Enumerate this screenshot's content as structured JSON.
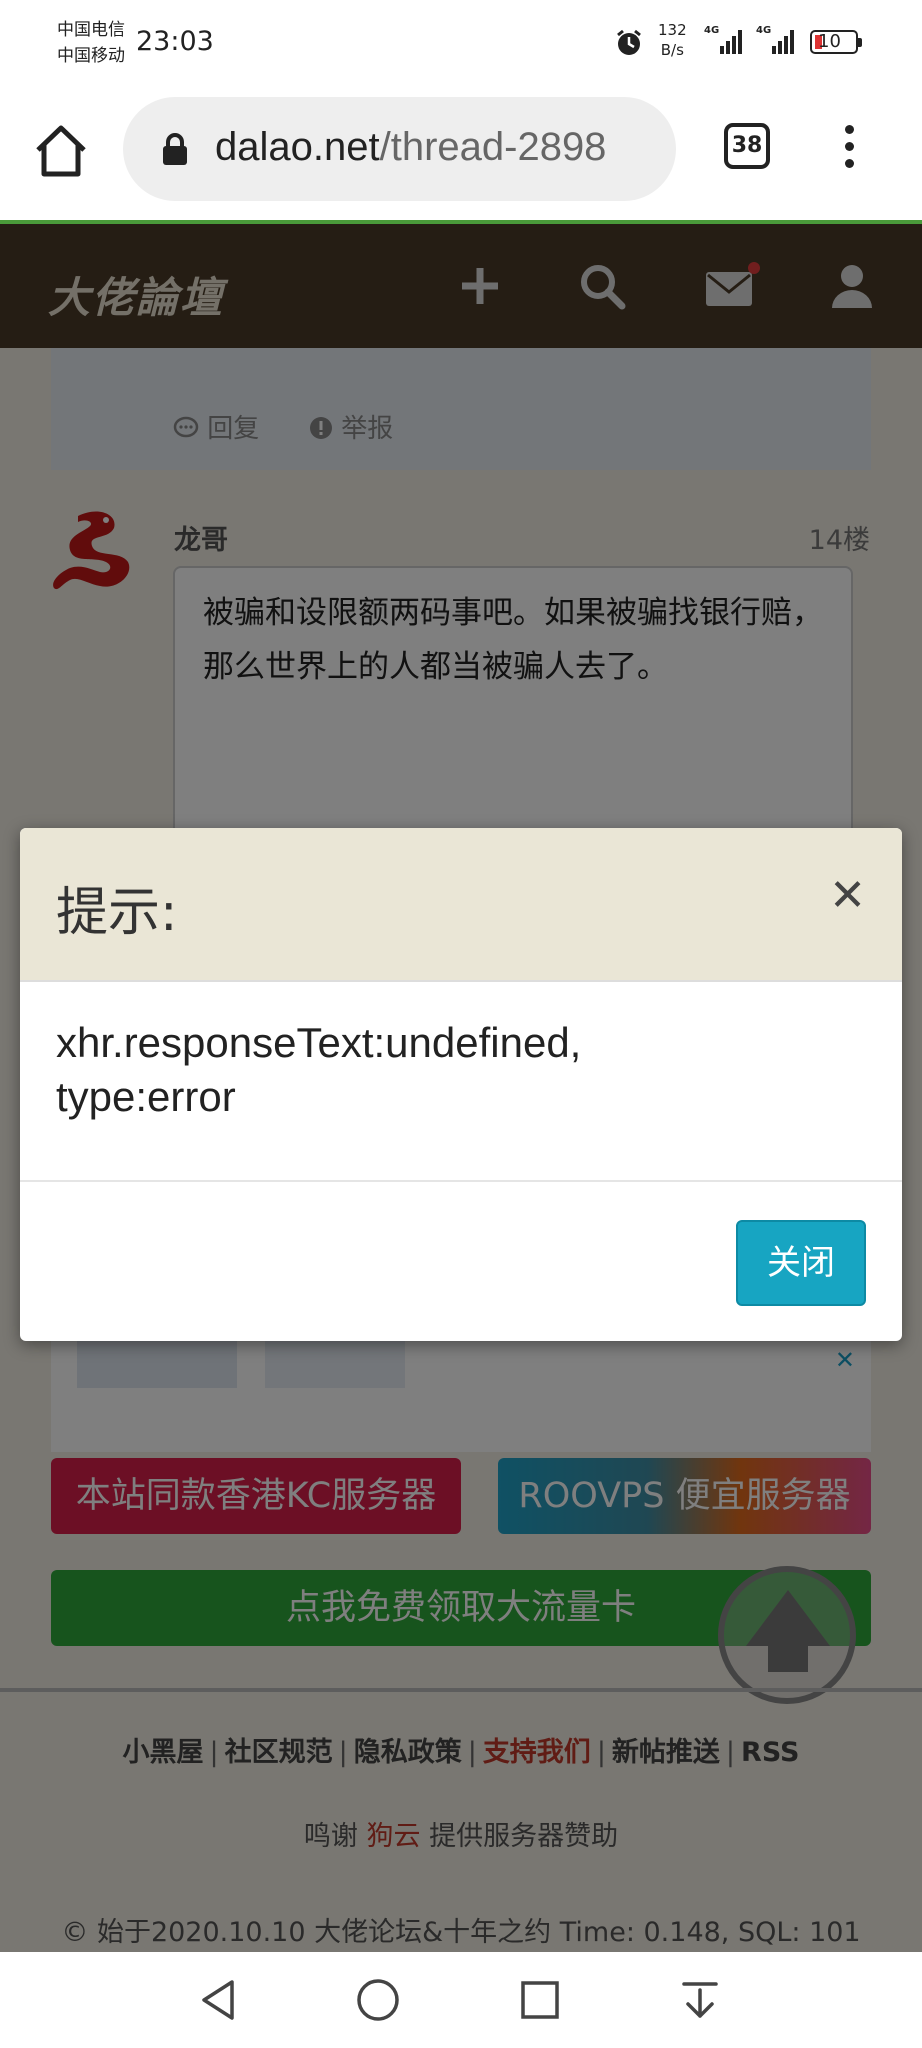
{
  "status_bar": {
    "carrier1": "中国电信",
    "carrier2": "中国移动",
    "time": "23:03",
    "net_speed_value": "132",
    "net_speed_unit": "B/s",
    "signal1_label": "4G",
    "signal2_label": "4G",
    "battery": "10"
  },
  "browser": {
    "url_domain": "dalao.net",
    "url_path": "/thread-2898",
    "tab_count": "38"
  },
  "site": {
    "logo": "大佬論壇"
  },
  "previous_post": {
    "reply": "回复",
    "report": "举报"
  },
  "post": {
    "author": "龙哥",
    "floor": "14楼",
    "text": "被骗和设限额两码事吧。如果被骗找银行赔，那么世界上的人都当被骗人去了。"
  },
  "promo": {
    "hk_server": "本站同款香港KC服务器",
    "roovps": "ROOVPS 便宜服务器",
    "data_card": "点我免费领取大流量卡"
  },
  "footer": {
    "links": [
      "小黑屋",
      "社区规范",
      "隐私政策",
      "支持我们",
      "新帖推送",
      "RSS"
    ],
    "thanks_prefix": "鸣谢",
    "thanks_sponsor": "狗云",
    "thanks_suffix": "提供服务器赞助",
    "copyright": "© 始于2020.10.10 大佬论坛&十年之约 Time: 0.148, SQL: 101"
  },
  "modal": {
    "title": "提示:",
    "message_line1": "xhr.responseText:undefined,",
    "message_line2": "type:error",
    "close_label": "关闭"
  },
  "colors": {
    "header_bg": "#4a3a28",
    "modal_button": "#17a5c2",
    "hk_button": "#d81e4a",
    "card_button": "#2fa83a",
    "highlight": "#c0392b"
  }
}
